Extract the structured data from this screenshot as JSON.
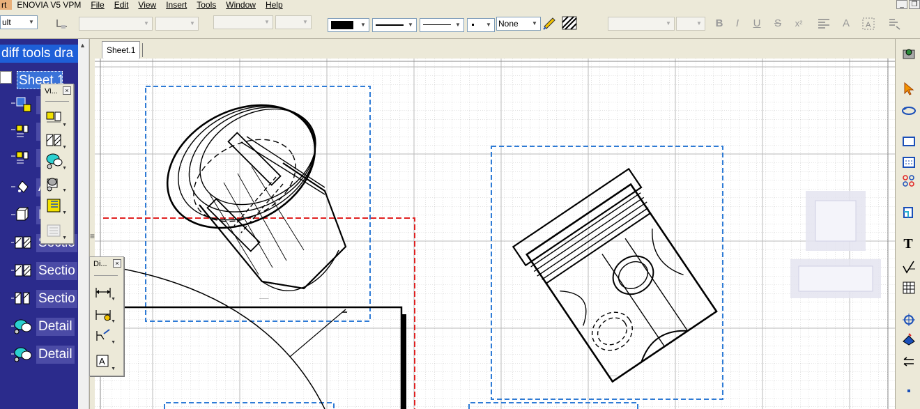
{
  "menubar": {
    "start": "rt",
    "items": [
      {
        "label": "ENOVIA V5 VPM"
      },
      {
        "label": "File"
      },
      {
        "label": "Edit"
      },
      {
        "label": "View"
      },
      {
        "label": "Insert"
      },
      {
        "label": "Tools"
      },
      {
        "label": "Window"
      },
      {
        "label": "Help"
      }
    ]
  },
  "window_controls": {
    "minimize": "_",
    "restore": "❐"
  },
  "toolbar": {
    "style_value": "ult",
    "line_thickness_value": "None",
    "bold_label": "B",
    "italic_label": "I",
    "underline_label": "U",
    "strike_label": "S",
    "strikethrough_label": "S",
    "superscript_label": "x²",
    "text_frame_label": "A"
  },
  "tree": {
    "title": "diff tools dra",
    "sheet": "Sheet.1",
    "items": [
      {
        "label": ""
      },
      {
        "label": ""
      },
      {
        "label": ""
      },
      {
        "label": "A"
      },
      {
        "label": "I"
      },
      {
        "label": "Sectio"
      },
      {
        "label": "Sectio"
      },
      {
        "label": "Sectio"
      },
      {
        "label": "Detail"
      },
      {
        "label": "Detail"
      }
    ]
  },
  "tabs": [
    {
      "label": "Sheet.1"
    }
  ],
  "views_panel": {
    "title": "Vi..."
  },
  "dimension_panel": {
    "title": "Di..."
  },
  "right_toolbar": {
    "text_label": "T"
  },
  "colors": {
    "tree_bg": "#2b2b8c",
    "title_highlight": "#1e5fd8",
    "view_frame": "#2e7bd6",
    "section_line": "#e02020",
    "grid": "#c8c8c8"
  }
}
